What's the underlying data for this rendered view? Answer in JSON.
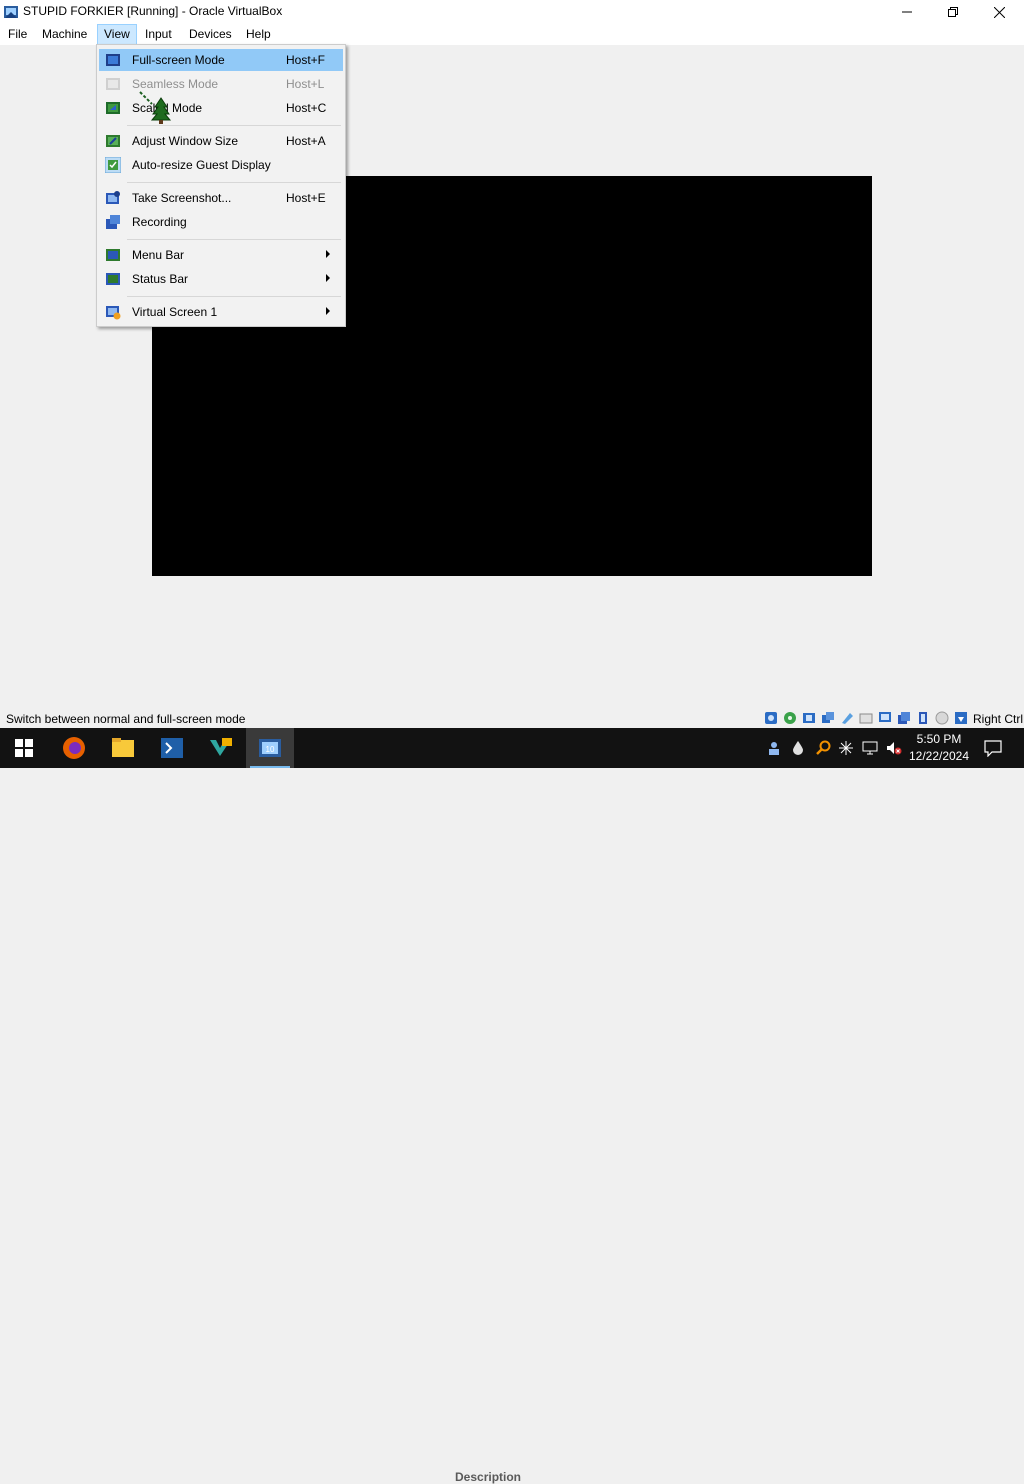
{
  "window": {
    "title": "STUPID FORKIER [Running] - Oracle VirtualBox",
    "icon": "virtualbox-icon",
    "controls": [
      "minimize-icon",
      "maximize-icon",
      "close-icon"
    ]
  },
  "menubar": {
    "items": [
      "File",
      "Machine",
      "View",
      "Input",
      "Devices",
      "Help"
    ],
    "active": "View"
  },
  "view_menu": {
    "items": [
      {
        "label": "Full-screen Mode",
        "accel": "Host+F",
        "icon": "fullscreen-icon",
        "highlighted": true,
        "enabled": true
      },
      {
        "label": "Seamless Mode",
        "accel": "Host+L",
        "icon": "seamless-icon",
        "enabled": false
      },
      {
        "label": "Scaled Mode",
        "accel": "Host+C",
        "icon": "scaled-icon",
        "enabled": true
      },
      {
        "label": "Adjust Window Size",
        "accel": "Host+A",
        "icon": "adjust-window-icon",
        "enabled": true
      },
      {
        "label": "Auto-resize Guest Display",
        "accel": "",
        "icon": "auto-resize-icon",
        "enabled": true,
        "checked": true
      },
      {
        "label": "Take Screenshot...",
        "accel": "Host+E",
        "icon": "screenshot-icon",
        "enabled": true
      },
      {
        "label": "Recording",
        "accel": "",
        "icon": "recording-icon",
        "enabled": true
      },
      {
        "label": "Menu Bar",
        "accel": "",
        "icon": "menu-bar-icon",
        "submenu": true,
        "enabled": true
      },
      {
        "label": "Status Bar",
        "accel": "",
        "icon": "status-bar-icon",
        "submenu": true,
        "enabled": true
      },
      {
        "label": "Virtual Screen 1",
        "accel": "",
        "icon": "virtual-screen-icon",
        "submenu": true,
        "enabled": true
      }
    ]
  },
  "statusbar": {
    "text": "Switch between normal and full-screen mode",
    "host_key": "Right Ctrl",
    "icons": [
      "hard-disk-icon",
      "optical-drive-icon",
      "audio-icon",
      "network-icon",
      "usb-icon",
      "shared-folders-icon",
      "display-icon",
      "recording-icon",
      "capture-icon",
      "cpu-icon",
      "keyboard-icon",
      "mouse-icon",
      "download-icon"
    ]
  },
  "taskbar": {
    "apps": [
      "windows-start-icon",
      "firefox-icon",
      "file-explorer-icon",
      "powershell-icon",
      "visual-studio-icon",
      "virtualbox-icon"
    ],
    "active_app": "virtualbox-icon",
    "ghost_text": "Description",
    "tray_icons": [
      "people-icon",
      "drop-icon",
      "search-icon",
      "network-icon",
      "monitor-icon",
      "volume-muted-icon"
    ],
    "time": "5:50 PM",
    "date": "12/22/2024",
    "notification_icon": "notification-icon"
  },
  "colors": {
    "highlight": "#91c9f7",
    "menu_active": "#cce8ff",
    "taskbar": "#121212",
    "guest_screen": "#000000"
  }
}
